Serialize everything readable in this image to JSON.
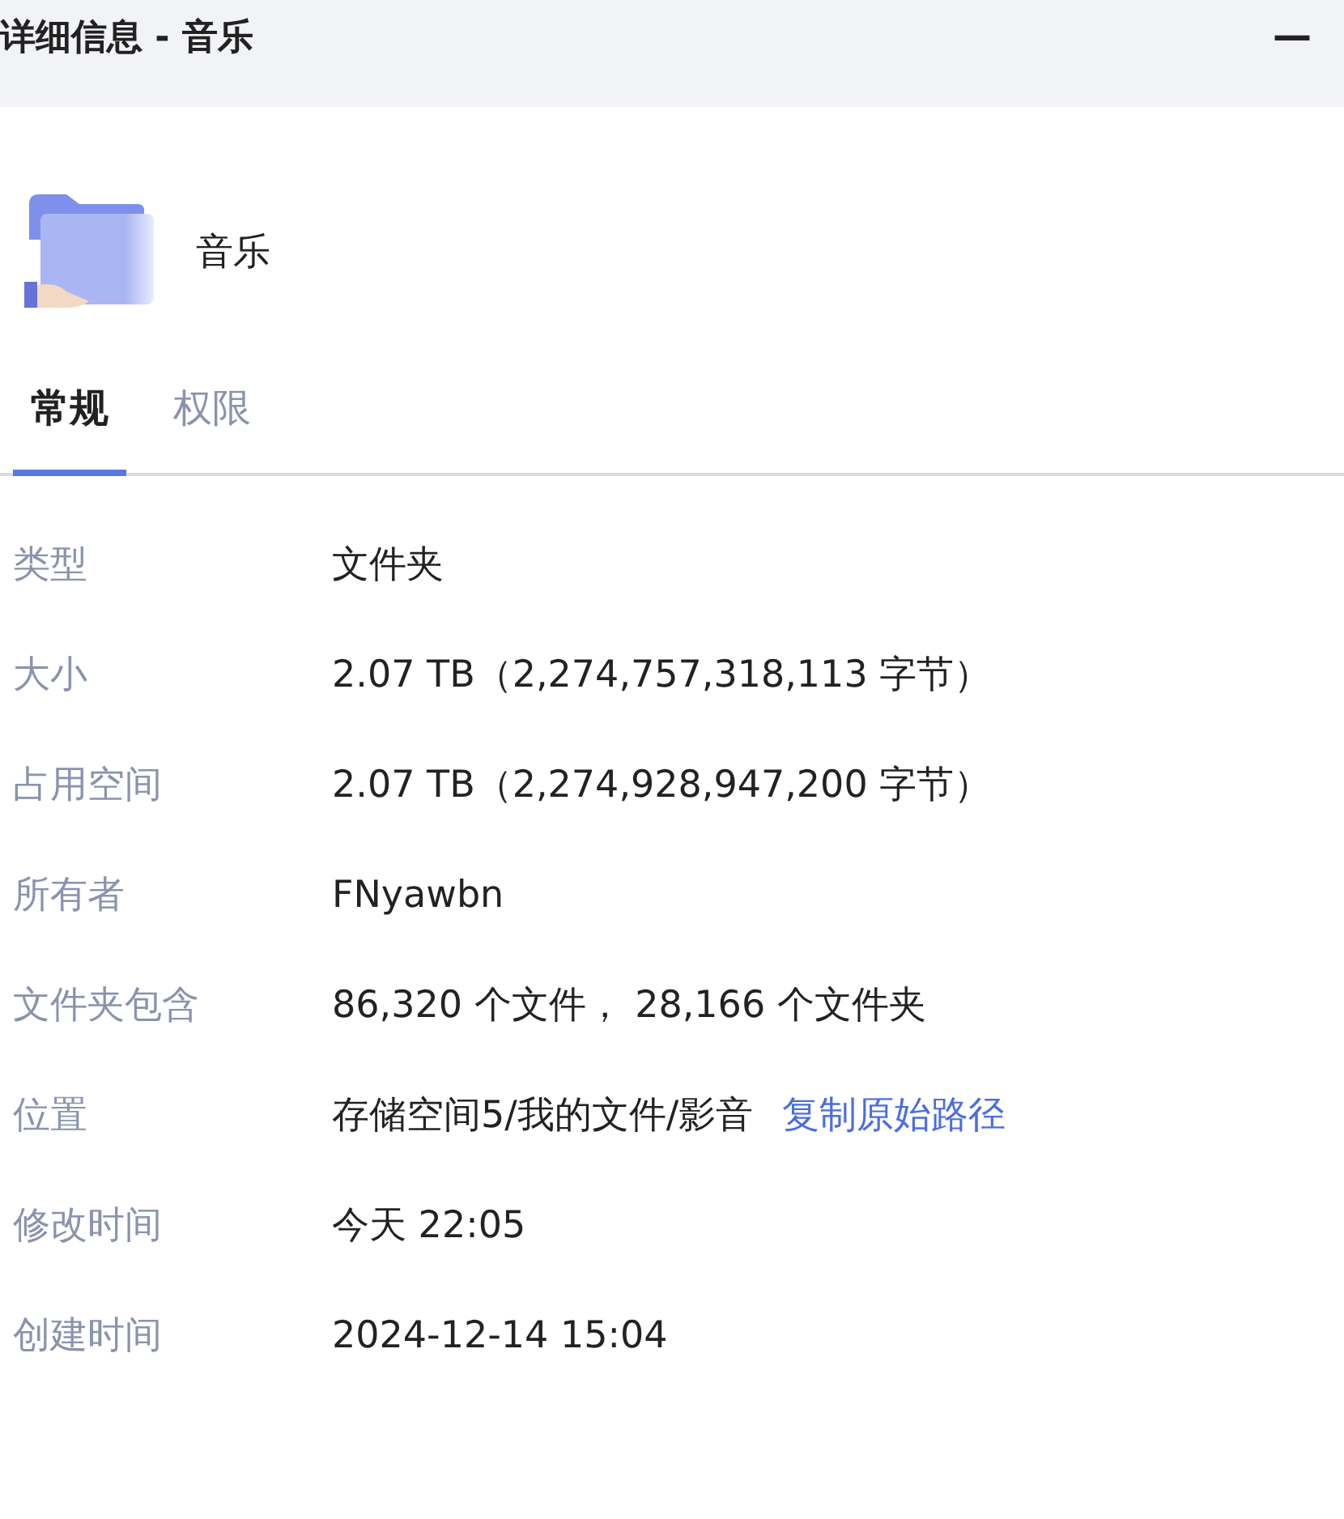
{
  "window": {
    "title": "详细信息 - 音乐",
    "minimize": "—"
  },
  "item": {
    "name": "音乐"
  },
  "tabs": [
    {
      "label": "常规",
      "selected": true
    },
    {
      "label": "权限",
      "selected": false
    }
  ],
  "properties": [
    {
      "label": "类型",
      "value": "文件夹"
    },
    {
      "label": "大小",
      "value": "2.07 TB（2,274,757,318,113 字节）"
    },
    {
      "label": "占用空间",
      "value": "2.07 TB（2,274,928,947,200 字节）"
    },
    {
      "label": "所有者",
      "value": "FNyawbn"
    },
    {
      "label": "文件夹包含",
      "value": "86,320 个文件， 28,166 个文件夹"
    },
    {
      "label": "位置",
      "value": "存储空间5/我的文件/影音",
      "link": "复制原始路径"
    },
    {
      "label": "修改时间",
      "value": "今天 22:05"
    },
    {
      "label": "创建时间",
      "value": "2024-12-14 15:04"
    }
  ]
}
